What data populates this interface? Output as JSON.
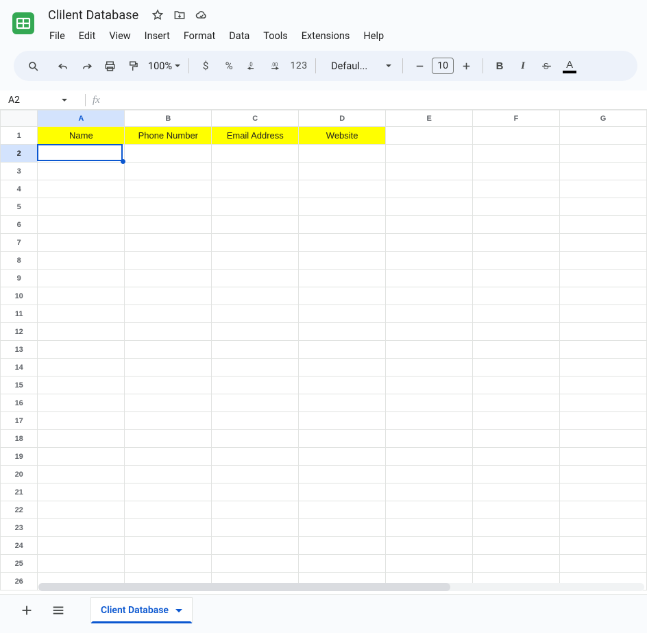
{
  "doc": {
    "title": "Clilent Database"
  },
  "menubar": {
    "file": "File",
    "edit": "Edit",
    "view": "View",
    "insert": "Insert",
    "format": "Format",
    "data": "Data",
    "tools": "Tools",
    "extensions": "Extensions",
    "help": "Help"
  },
  "toolbar": {
    "zoom": "100%",
    "currency": "$",
    "percent": "%",
    "num123": "123",
    "font_family": "Defaul...",
    "font_size": "10",
    "bold": "B",
    "italic": "I",
    "text_color_letter": "A",
    "text_color_value": "#000000"
  },
  "name_box": {
    "value": "A2"
  },
  "formula_bar": {
    "fx": "fx",
    "value": ""
  },
  "columns": [
    "A",
    "B",
    "C",
    "D",
    "E",
    "F",
    "G"
  ],
  "row_count": 26,
  "selected_cell": {
    "col": 0,
    "row": 2
  },
  "header_row": {
    "bg": "#ffff00",
    "cells": [
      "Name",
      "Phone Number",
      "Email Address",
      "Website"
    ]
  },
  "sheet_tabs": {
    "active": "Client Database"
  }
}
